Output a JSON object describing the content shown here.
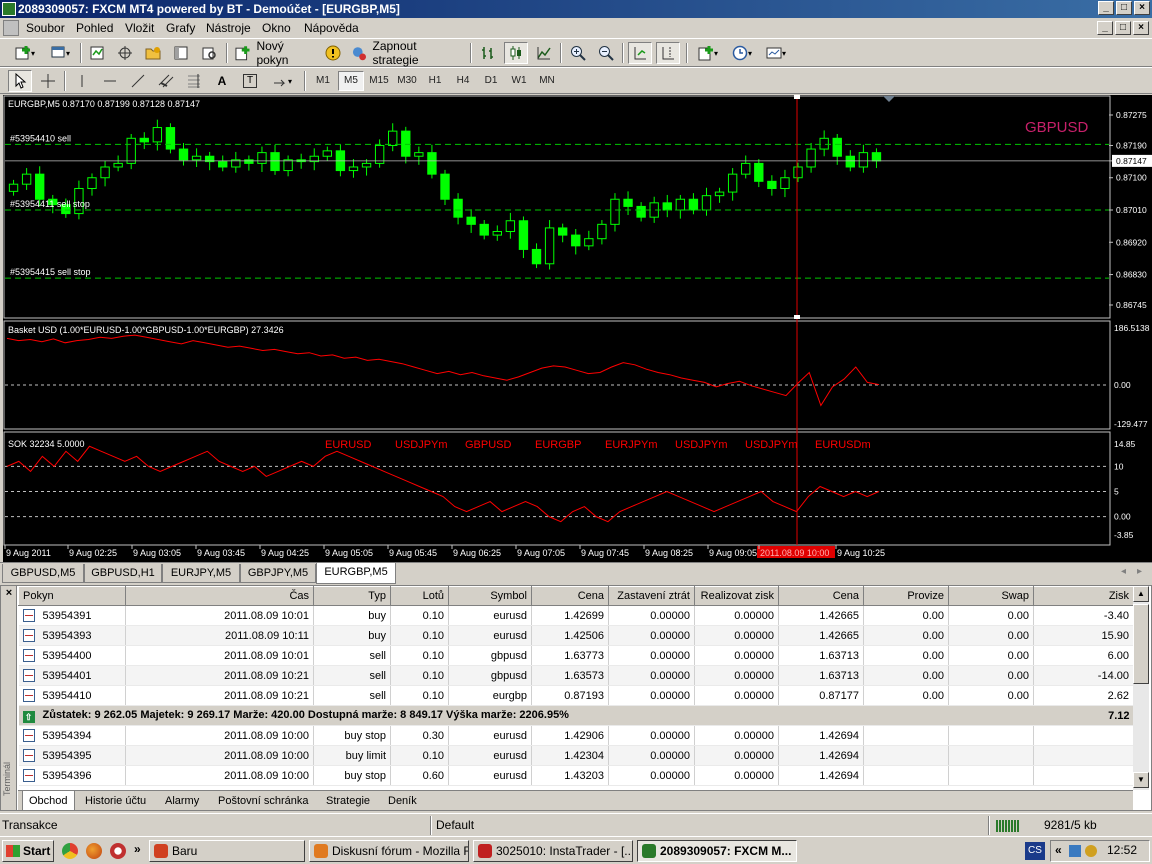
{
  "window": {
    "title": "2089309057: FXCM MT4 powered by BT - Demoúčet - [EURGBP,M5]",
    "controls": [
      "_",
      "□",
      "×"
    ]
  },
  "menu": {
    "items": [
      "Soubor",
      "Pohled",
      "Vložit",
      "Grafy",
      "Nástroje",
      "Okno",
      "Nápověda"
    ]
  },
  "toolbar1": {
    "new_order_label": "Nový pokyn",
    "strategies_label": "Zapnout strategie"
  },
  "toolbar2": {
    "drawing_tools": [
      "A",
      "T"
    ],
    "timeframes": [
      "M1",
      "M5",
      "M15",
      "M30",
      "H1",
      "H4",
      "D1",
      "W1",
      "MN"
    ],
    "active_timeframe": "M5"
  },
  "chart": {
    "info": "EURGBP,M5  0.87170 0.87199 0.87128 0.87147",
    "watermark": "GBPUSD",
    "orders": [
      {
        "label": "#53954410 sell",
        "price": 0.87193
      },
      {
        "label": "#53954411  sell stop",
        "price": 0.8701
      },
      {
        "label": "#53954415 sell stop",
        "price": 0.8682
      }
    ],
    "price_axis": [
      "0.87275",
      "0.87190",
      "0.87147",
      "0.87100",
      "0.87010",
      "0.86920",
      "0.86830",
      "0.86745"
    ],
    "current_price": "0.87147",
    "time_axis": [
      "9 Aug 2011",
      "9 Aug 02:25",
      "9 Aug 03:05",
      "9 Aug 03:45",
      "9 Aug 04:25",
      "9 Aug 05:05",
      "9 Aug 05:45",
      "9 Aug 06:25",
      "9 Aug 07:05",
      "9 Aug 07:45",
      "9 Aug 08:25",
      "9 Aug 09:05",
      "2011.08.09 10:00",
      "9 Aug 10:25"
    ],
    "cursor_time": "2011.08.09 10:00",
    "indicator1": {
      "label": "Basket USD (1.00*EURUSD-1.00*GBPUSD-1.00*EURGBP) 27.3426",
      "axis": [
        "186.5138",
        "0.00",
        "-129.477"
      ]
    },
    "indicator2": {
      "label": "SOK 32234 5.0000",
      "symbols": [
        "EURUSD",
        "USDJPYm",
        "GBPUSD",
        "EURGBP",
        "EURJPYm",
        "USDJPYm",
        "USDJPYm",
        "EURUSDm"
      ],
      "axis": [
        "14.85",
        "10",
        "5",
        "0.00",
        "-3.85"
      ]
    },
    "colors": {
      "up": "#00ff00",
      "level": "#00c800",
      "indicator": "#ff0000",
      "watermark": "#c8206a",
      "grid": "#c0c0c0"
    }
  },
  "chart_data": {
    "type": "candlestick",
    "symbol": "EURGBP",
    "timeframe": "M5",
    "ylim": [
      0.86745,
      0.87275
    ],
    "close_path": [
      0.87082,
      0.8711,
      0.8704,
      0.87025,
      0.87,
      0.8707,
      0.871,
      0.8713,
      0.8714,
      0.8721,
      0.872,
      0.8724,
      0.8718,
      0.8715,
      0.8716,
      0.87145,
      0.8713,
      0.8715,
      0.8714,
      0.8717,
      0.8712,
      0.8715,
      0.87145,
      0.8716,
      0.87175,
      0.8712,
      0.8713,
      0.8714,
      0.8719,
      0.8723,
      0.8716,
      0.8717,
      0.8711,
      0.8704,
      0.8699,
      0.8697,
      0.8694,
      0.8695,
      0.8698,
      0.869,
      0.8686,
      0.8696,
      0.8694,
      0.8691,
      0.8693,
      0.8697,
      0.8704,
      0.8702,
      0.8699,
      0.8703,
      0.8701,
      0.8704,
      0.8701,
      0.8705,
      0.8706,
      0.8711,
      0.8714,
      0.8709,
      0.8707,
      0.871,
      0.8713,
      0.8718,
      0.8721,
      0.8716,
      0.8713,
      0.8717,
      0.87147
    ]
  },
  "chart_tabs": [
    "GBPUSD,M5",
    "GBPUSD,H1",
    "EURJPY,M5",
    "GBPJPY,M5",
    "EURGBP,M5"
  ],
  "active_chart_tab": "EURGBP,M5",
  "terminal": {
    "columns": [
      "Pokyn",
      "Čas",
      "Typ",
      "Lotů",
      "Symbol",
      "Cena",
      "Zastavení ztrát",
      "Realizovat zisk",
      "Cena",
      "Provize",
      "Swap",
      "Zisk"
    ],
    "open_orders": [
      [
        "53954391",
        "2011.08.09 10:01",
        "buy",
        "0.10",
        "eurusd",
        "1.42699",
        "0.00000",
        "0.00000",
        "1.42665",
        "0.00",
        "0.00",
        "-3.40"
      ],
      [
        "53954393",
        "2011.08.09 10:11",
        "buy",
        "0.10",
        "eurusd",
        "1.42506",
        "0.00000",
        "0.00000",
        "1.42665",
        "0.00",
        "0.00",
        "15.90"
      ],
      [
        "53954400",
        "2011.08.09 10:01",
        "sell",
        "0.10",
        "gbpusd",
        "1.63773",
        "0.00000",
        "0.00000",
        "1.63713",
        "0.00",
        "0.00",
        "6.00"
      ],
      [
        "53954401",
        "2011.08.09 10:21",
        "sell",
        "0.10",
        "gbpusd",
        "1.63573",
        "0.00000",
        "0.00000",
        "1.63713",
        "0.00",
        "0.00",
        "-14.00"
      ],
      [
        "53954410",
        "2011.08.09 10:21",
        "sell",
        "0.10",
        "eurgbp",
        "0.87193",
        "0.00000",
        "0.00000",
        "0.87177",
        "0.00",
        "0.00",
        "2.62"
      ]
    ],
    "balance_text": "Zůstatek: 9 262.05  Majetek: 9 269.17  Marže: 420.00  Dostupná marže: 8 849.17  Výška marže: 2206.95%",
    "balance_profit": "7.12",
    "pending_orders": [
      [
        "53954394",
        "2011.08.09 10:00",
        "buy stop",
        "0.30",
        "eurusd",
        "1.42906",
        "0.00000",
        "0.00000",
        "1.42694",
        "",
        "",
        ""
      ],
      [
        "53954395",
        "2011.08.09 10:00",
        "buy limit",
        "0.10",
        "eurusd",
        "1.42304",
        "0.00000",
        "0.00000",
        "1.42694",
        "",
        "",
        ""
      ],
      [
        "53954396",
        "2011.08.09 10:00",
        "buy stop",
        "0.60",
        "eurusd",
        "1.43203",
        "0.00000",
        "0.00000",
        "1.42694",
        "",
        "",
        ""
      ]
    ],
    "side_label": "Terminál",
    "tabs": [
      "Obchod",
      "Historie účtu",
      "Alarmy",
      "Poštovní schránka",
      "Strategie",
      "Deník"
    ],
    "active_tab": "Obchod"
  },
  "statusbar": {
    "left": "Transakce",
    "profile": "Default",
    "traffic": "9281/5 kb"
  },
  "taskbar": {
    "start": "Start",
    "more": "»",
    "tasks": [
      "Baru",
      "Diskusní fórum - Mozilla F...",
      "3025010: InstaTrader - [...",
      "2089309057: FXCM M..."
    ],
    "active_task": "2089309057: FXCM M...",
    "lang": "CS",
    "tray_more": "«",
    "clock": "12:52"
  }
}
